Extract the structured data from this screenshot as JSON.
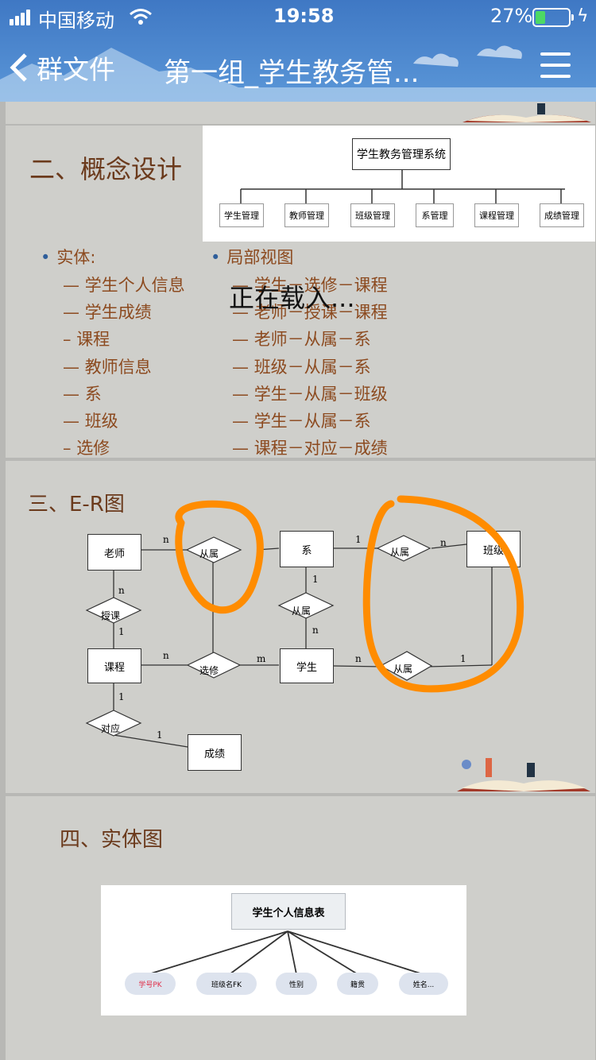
{
  "status_bar": {
    "carrier": "中国移动",
    "time": "19:58",
    "battery": "27%"
  },
  "nav": {
    "back_label": "群文件",
    "title": "第一组_学生教务管..."
  },
  "slide2": {
    "heading": "二、概念设计",
    "org": {
      "root": "学生教务管理系统",
      "children": [
        "学生管理",
        "教师管理",
        "班级管理",
        "系管理",
        "课程管理",
        "成绩管理"
      ]
    },
    "entities_label": "实体:",
    "entities": [
      "学生个人信息",
      "学生成绩",
      "课程",
      "教师信息",
      "系",
      "班级",
      "选修"
    ],
    "views_label": "局部视图",
    "views": [
      "学生－选修－课程",
      "老师－授课－课程",
      "老师－从属－系",
      "班级－从属－系",
      "学生－从属－班级",
      "学生－从属－系",
      "课程－对应－成绩"
    ],
    "loading": "正在载入..."
  },
  "slide3": {
    "heading": "三、E-R图",
    "entities": {
      "teacher": "老师",
      "dept": "系",
      "class": "班级",
      "course": "课程",
      "student": "学生",
      "score": "成绩"
    },
    "relations": {
      "belong": "从属",
      "teach": "授课",
      "elective": "选修",
      "correspond": "对应"
    },
    "card": {
      "n": "n",
      "one": "1",
      "m": "m"
    }
  },
  "slide4": {
    "heading": "四、实体图",
    "table": "学生个人信息表",
    "attrs": [
      "学号PK",
      "班级名FK",
      "性别",
      "籍贯",
      "姓名..."
    ]
  },
  "colors": {
    "annotation": "#ff8c00",
    "pk": "#e0304a"
  }
}
